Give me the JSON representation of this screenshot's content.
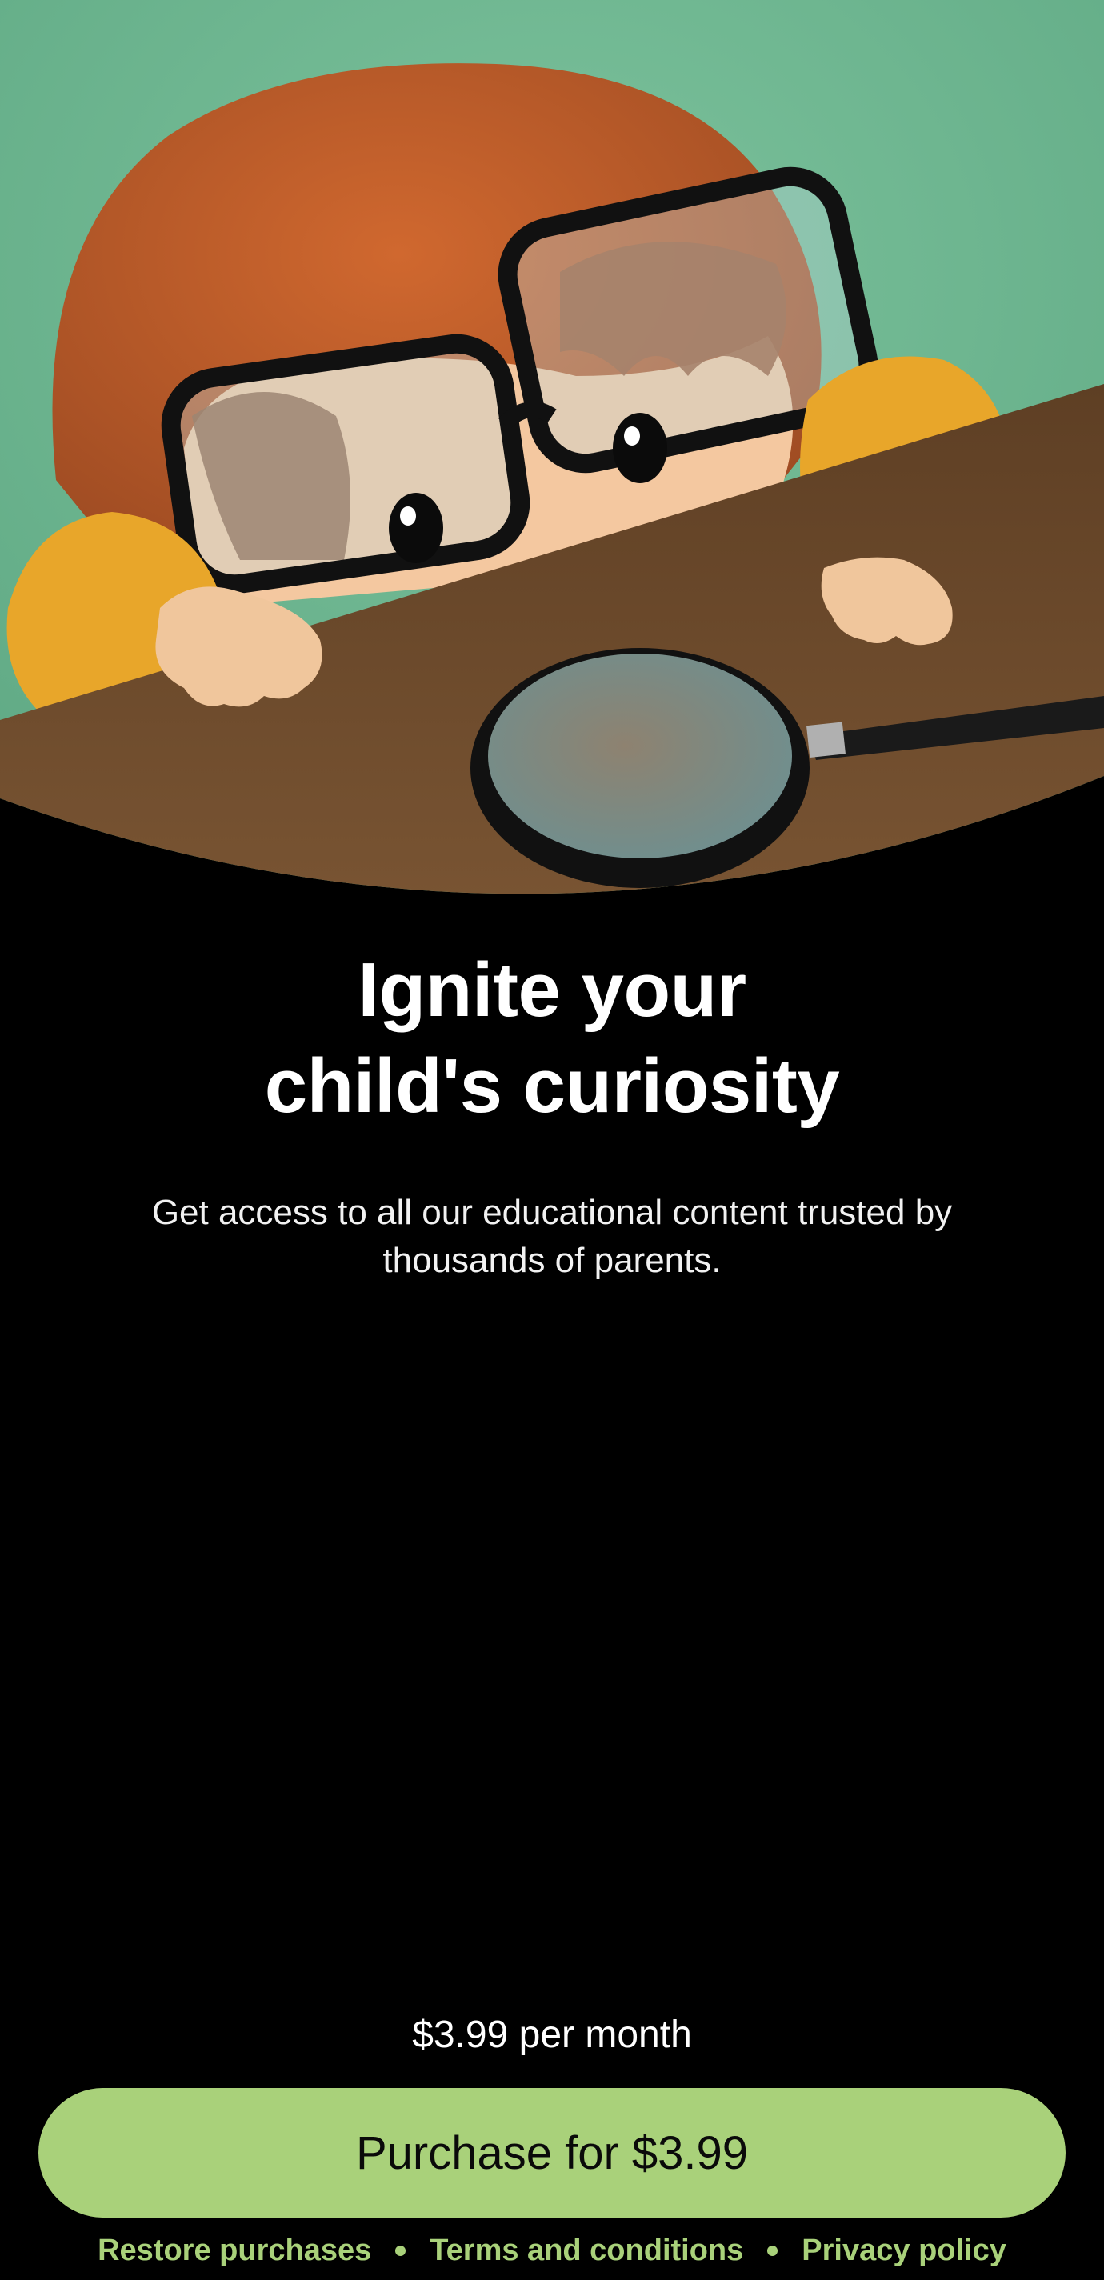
{
  "hero": {
    "illustration_icon": "child-with-glasses-and-magnifying-glass-illustration"
  },
  "title": {
    "line1": "Ignite your",
    "line2": "child's curiosity"
  },
  "subtitle": "Get access to all our educational content trusted by thousands of parents.",
  "pricing": {
    "price_text": "$3.99 per month",
    "purchase_label": "Purchase for $3.99"
  },
  "footer": {
    "restore_label": "Restore purchases",
    "terms_label": "Terms and conditions",
    "privacy_label": "Privacy policy",
    "separator_icon": "dot-separator-icon"
  },
  "colors": {
    "background": "#000000",
    "accent": "#a9d17a",
    "button_text": "#0a0a0a",
    "hero_background": "#6fb892",
    "table": "#6e4a2b",
    "hair": "#b5582a",
    "sweater": "#e8a62a"
  }
}
